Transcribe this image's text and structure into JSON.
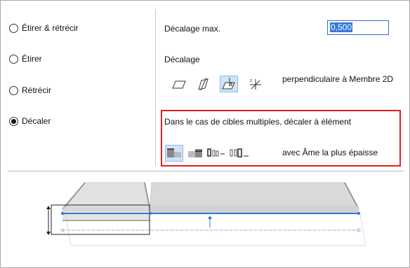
{
  "options": [
    {
      "label": "Étirer & rétrécir",
      "checked": false
    },
    {
      "label": "Étirer",
      "checked": false
    },
    {
      "label": "Rétrécir",
      "checked": false
    },
    {
      "label": "Décaler",
      "checked": true
    }
  ],
  "max_offset": {
    "label": "Décalage max.",
    "value": "0,500"
  },
  "offset": {
    "label": "Décalage",
    "icons": [
      "parallelogram-offset-icon",
      "diagonal-offset-icon",
      "perpendicular-offset-icon",
      "xyz-axis-offset-icon"
    ],
    "active_icon": 2,
    "description": "perpendiculaire à Membre 2D"
  },
  "multiple_targets": {
    "heading": "Dans le cas de cibles multiples, décaler à élément",
    "icons": [
      "thickest-layer-icon",
      "thinnest-layer-icon",
      "core-thickest-icon",
      "core-thinnest-icon"
    ],
    "active_icon": 0,
    "description": "avec Âme la plus épaisse"
  },
  "colors": {
    "accent": "#3478d6",
    "highlight_border": "#e02020",
    "active_bg": "#cfe4fa"
  }
}
